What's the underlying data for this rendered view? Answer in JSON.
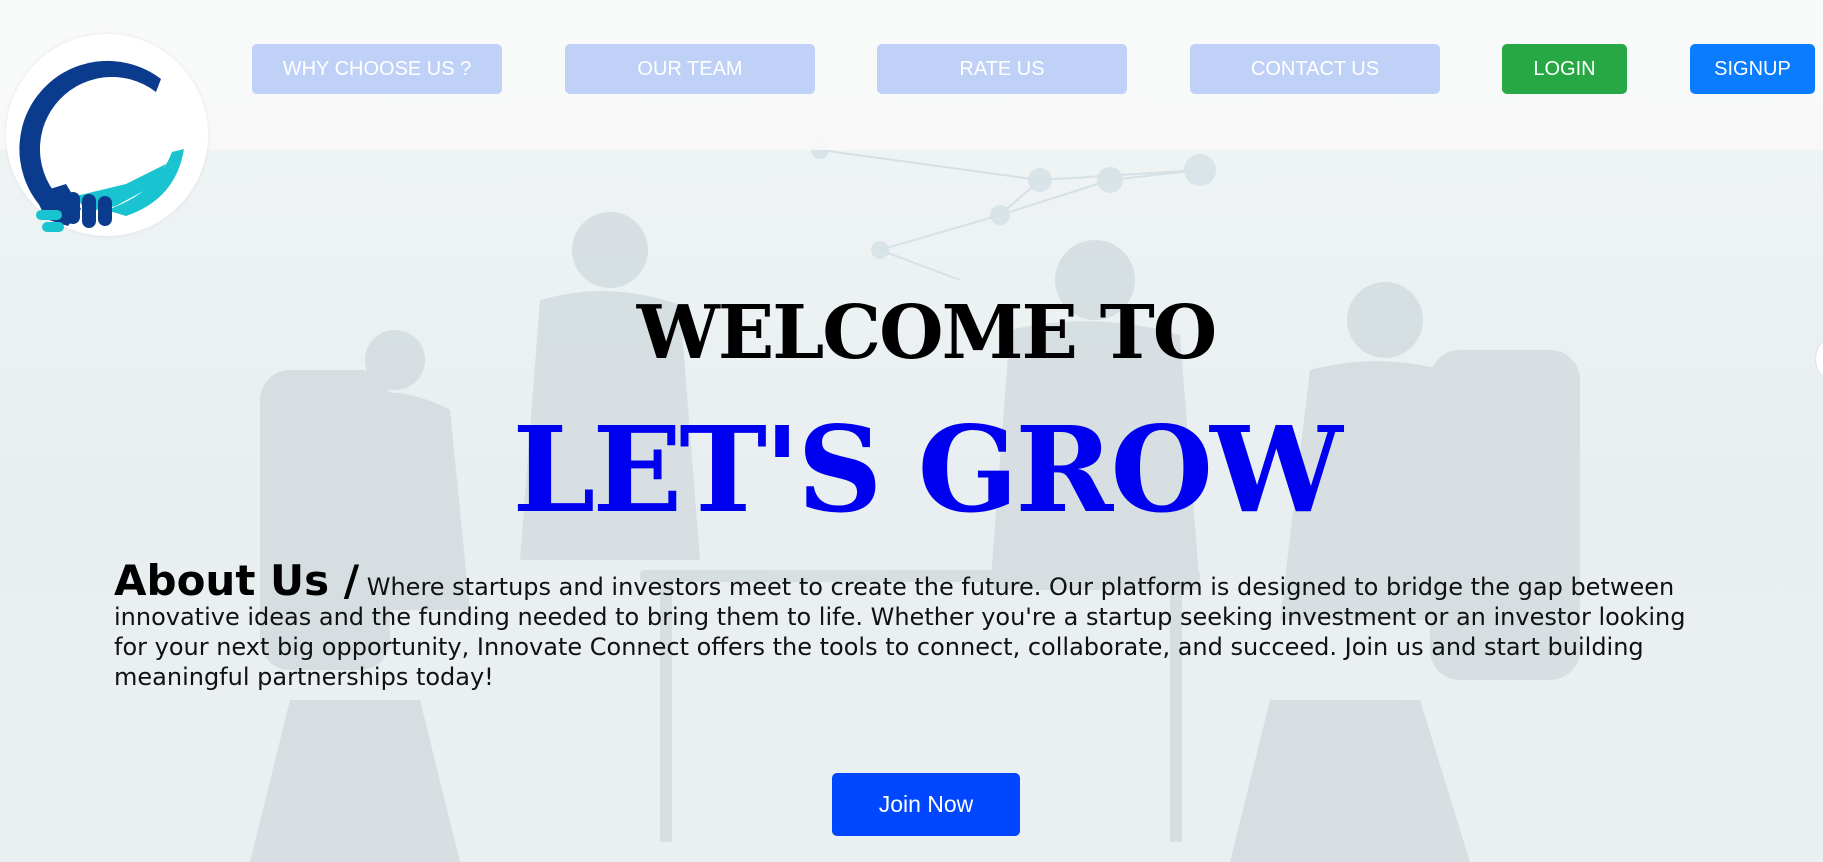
{
  "nav": {
    "items": [
      {
        "label": "WHY CHOOSE US ?"
      },
      {
        "label": "OUR TEAM"
      },
      {
        "label": "RATE US"
      },
      {
        "label": "CONTACT US"
      }
    ],
    "login_label": "LOGIN",
    "signup_label": "SIGNUP"
  },
  "logo": {
    "icon": "handshake-circle-logo"
  },
  "hero": {
    "welcome": "WELCOME TO",
    "brand": "LET'S GROW"
  },
  "about": {
    "heading": "About Us /",
    "text": "Where startups and investors meet to create the future. Our platform is designed to bridge the gap between innovative ideas and the funding needed to bring them to life. Whether you're a startup seeking investment or an investor looking for your next big opportunity, Innovate Connect offers the tools to connect, collaborate, and succeed. Join us and start building meaningful partnerships today!"
  },
  "cta": {
    "label": "Join Now"
  },
  "colors": {
    "nav_button": "#c0d1f8",
    "login": "#28a745",
    "signup": "#0a7cff",
    "brand_blue": "#0000f0",
    "join_button": "#0047ff",
    "logo_navy": "#0b3b8c",
    "logo_teal": "#19c3cf"
  }
}
